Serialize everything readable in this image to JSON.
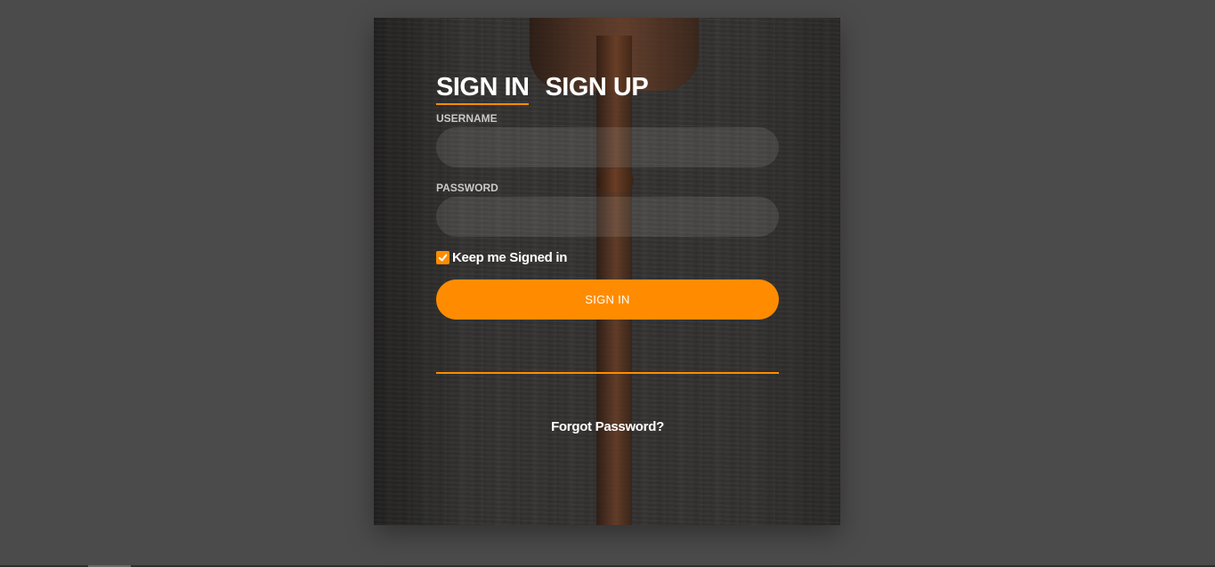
{
  "auth_card": {
    "tabs": [
      {
        "label": "SIGN IN",
        "active": true
      },
      {
        "label": "SIGN UP",
        "active": false
      }
    ],
    "username": {
      "label": "USERNAME",
      "value": "",
      "placeholder": ""
    },
    "password": {
      "label": "PASSWORD",
      "value": "",
      "placeholder": ""
    },
    "keep_signed_in": {
      "label": "Keep me Signed in",
      "checked": true
    },
    "submit_label": "SIGN IN",
    "forgot_label": "Forgot Password?"
  },
  "colors": {
    "page_background": "#4b4b4b",
    "accent": "#ff8c00",
    "text": "#ffffff"
  },
  "icons": {
    "checkbox": "checkmark-icon"
  }
}
